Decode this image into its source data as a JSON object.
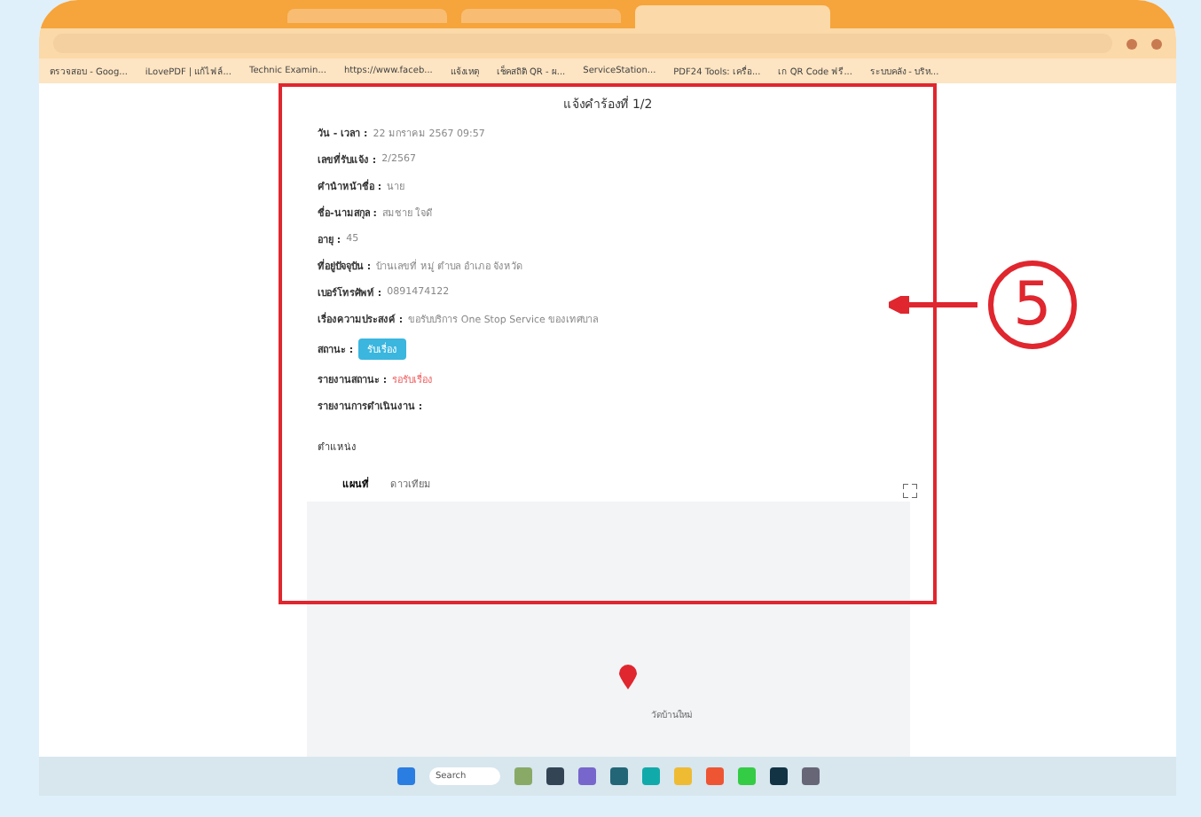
{
  "browser": {
    "tabs": [
      {
        "selected": false
      },
      {
        "selected": false
      },
      {
        "selected": true
      }
    ],
    "bookmarks": [
      "ตรวจสอบ - Goog...",
      "iLovePDF | แก้ไฟล์...",
      "Technic Examin...",
      "https://www.faceb...",
      "แจ้งเหตุ",
      "เช็คสถิติ QR - ผ...",
      "ServiceStation...",
      "PDF24 Tools: เครื่อ...",
      "เก QR Code ฟรี...",
      "ระบบคลัง - บริห..."
    ]
  },
  "detail": {
    "title": "แจ้งคำร้องที่ 1/2",
    "fields": [
      {
        "kind": "text",
        "label": "วัน - เวลา :",
        "value": "22 มกราคม 2567 09:57"
      },
      {
        "kind": "text",
        "label": "เลขที่รับแจ้ง :",
        "value": "2/2567"
      },
      {
        "kind": "text",
        "label": "คำนำหน้าชื่อ :",
        "value": "นาย"
      },
      {
        "kind": "text",
        "label": "ชื่อ-นามสกุล :",
        "value": "สมชาย ใจดี"
      },
      {
        "kind": "text",
        "label": "อายุ :",
        "value": "45"
      },
      {
        "kind": "text",
        "label": "ที่อยู่ปัจจุบัน :",
        "value": "บ้านเลขที่ หมู่ ตำบล อำเภอ จังหวัด"
      },
      {
        "kind": "text",
        "label": "เบอร์โทรศัพท์ :",
        "value": "0891474122"
      },
      {
        "kind": "text",
        "label": "เรื่องความประสงค์ :",
        "value": "ขอรับบริการ One Stop Service ของเทศบาล"
      },
      {
        "kind": "badge",
        "label": "สถานะ :",
        "value": "รับเรื่อง"
      },
      {
        "kind": "alert",
        "label": "รายงานสถานะ :",
        "value": "รอรับเรื่อง"
      },
      {
        "kind": "text",
        "label": "รายงานการดำเนินงาน :"
      }
    ],
    "map": {
      "label": "ตำแหน่ง",
      "tabs": [
        {
          "label": "แผนที่",
          "selected": true
        },
        {
          "label": "ดาวเทียม",
          "selected": false
        }
      ],
      "place": "วัดบ้านใหม่"
    }
  },
  "callout": {
    "number": "5"
  },
  "taskbar": {
    "search": "Search"
  }
}
